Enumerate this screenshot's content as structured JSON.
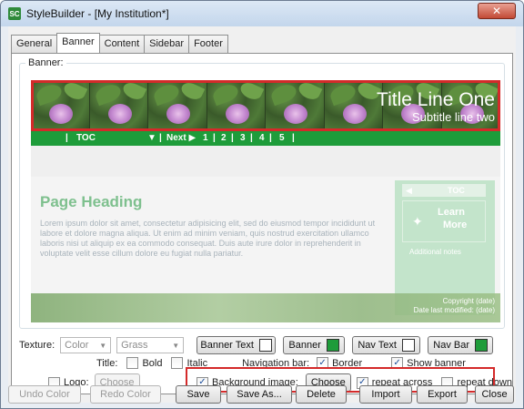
{
  "window": {
    "title": "StyleBuilder - [My Institution*]",
    "app_icon_text": "SC",
    "close_glyph": "✕"
  },
  "tabs": [
    {
      "label": "General",
      "active": false
    },
    {
      "label": "Banner",
      "active": true
    },
    {
      "label": "Content",
      "active": false
    },
    {
      "label": "Sidebar",
      "active": false
    },
    {
      "label": "Footer",
      "active": false
    }
  ],
  "banner_group": {
    "legend": "Banner:",
    "preview": {
      "title": "Title Line One",
      "subtitle": "Subtitle line two",
      "nav": [
        "|",
        "TOC",
        "▼",
        "|",
        "Next ▶",
        "1",
        "|",
        "2",
        "|",
        "3",
        "|",
        "4",
        "|",
        "5",
        "|"
      ],
      "page_heading": "Page Heading",
      "lorem": "Lorem ipsum dolor sit amet, consectetur adipisicing elit, sed do eiusmod tempor incididunt ut labore et dolore magna aliqua. Ut enim ad minim veniam, quis nostrud exercitation ullamco laboris nisi ut aliquip ex ea commodo consequat. Duis aute irure dolor in reprehenderit in voluptate velit esse cillum dolore eu fugiat nulla pariatur.",
      "sidebar": {
        "toc_arrow": "◀",
        "toc_label": "TOC",
        "learn_line1": "Learn",
        "learn_line2": "More",
        "notes": "Additional notes"
      },
      "copyright": "Copyright (date)",
      "last_modified": "Date last modified: (date)"
    }
  },
  "controls": {
    "texture_label": "Texture:",
    "texture_value": "Color",
    "texture_pattern_value": "Grass",
    "banner_text_button": "Banner Text",
    "banner_button": "Banner",
    "nav_text_button": "Nav Text",
    "nav_bar_button": "Nav Bar",
    "banner_text_color": "#ffffff",
    "banner_color": "#1e9c3a",
    "nav_text_color": "#ffffff",
    "nav_bar_color": "#1e9c3a",
    "title_label": "Title:",
    "bold_label": "Bold",
    "bold_checked": false,
    "italic_label": "Italic",
    "italic_checked": false,
    "navbar_label": "Navigation bar:",
    "border_label": "Border",
    "border_checked": true,
    "show_banner_label": "Show banner",
    "show_banner_checked": true,
    "logo_label": "Logo:",
    "logo_checked": false,
    "logo_choose_button": "Choose",
    "bg_image_label": "Background image:",
    "bg_image_checked": true,
    "bg_choose_button": "Choose",
    "repeat_across_label": "repeat across",
    "repeat_across_checked": true,
    "repeat_down_label": "repeat down",
    "repeat_down_checked": false
  },
  "bottom_buttons": {
    "undo": "Undo Color",
    "redo": "Redo Color",
    "save": "Save",
    "save_as": "Save As...",
    "delete": "Delete",
    "import": "Import",
    "export": "Export",
    "close": "Close"
  },
  "colors": {
    "highlight_red": "#d42a2a",
    "nav_green": "#1e9c3a",
    "heading_green": "#7ec08e"
  }
}
